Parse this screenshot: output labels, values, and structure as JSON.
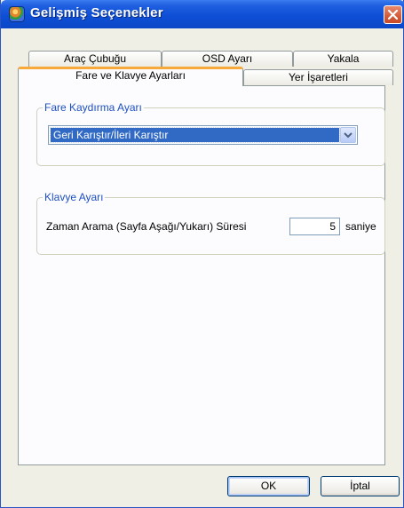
{
  "window": {
    "title": "Gelişmiş Seçenekler"
  },
  "tabs": {
    "row_back": [
      "Araç Çubuğu",
      "OSD Ayarı",
      "Yakala"
    ],
    "row_front_active": "Fare ve Klavye Ayarları",
    "row_front_other": "Yer İşaretleri"
  },
  "mouse_group": {
    "legend": "Fare Kaydırma Ayarı",
    "select_value": "Geri Karıştır/İleri Karıştır"
  },
  "keyboard_group": {
    "legend": "Klavye Ayarı",
    "label": "Zaman Arama (Sayfa Aşağı/Yukarı) Süresi",
    "value": "5",
    "unit": "saniye"
  },
  "buttons": {
    "ok": "OK",
    "cancel": "İptal"
  }
}
